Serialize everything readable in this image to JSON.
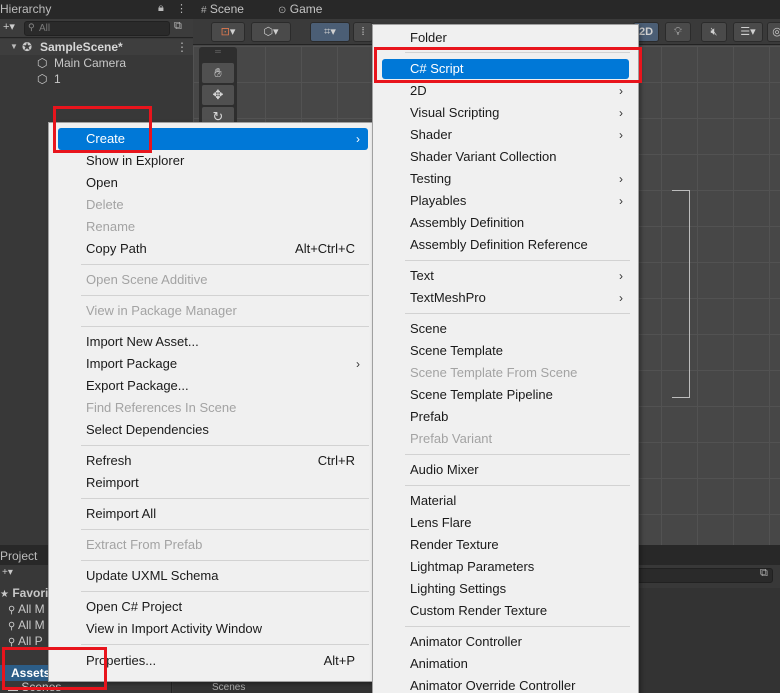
{
  "hierarchy": {
    "title": "Hierarchy",
    "search_placeholder": "All",
    "scene_name": "SampleScene*",
    "objects": [
      "Main Camera",
      "1"
    ]
  },
  "scene": {
    "tabs": [
      "Scene",
      "Game"
    ],
    "toggle_2d": "2D"
  },
  "project": {
    "title": "Project",
    "favorites": "Favorit",
    "fav_items": [
      "All M",
      "All M",
      "All P"
    ],
    "assets": "Assets",
    "scenes_left": "Scenes",
    "scenes_right": "Scenes"
  },
  "context_menu": {
    "items": [
      {
        "label": "Create",
        "highlighted": true,
        "submenu": true
      },
      {
        "label": "Show in Explorer"
      },
      {
        "label": "Open"
      },
      {
        "label": "Delete",
        "disabled": true
      },
      {
        "label": "Rename",
        "disabled": true
      },
      {
        "label": "Copy Path",
        "shortcut": "Alt+Ctrl+C"
      },
      {
        "label": "Open Scene Additive",
        "disabled": true
      },
      {
        "label": "View in Package Manager",
        "disabled": true
      },
      {
        "label": "Import New Asset..."
      },
      {
        "label": "Import Package",
        "submenu": true
      },
      {
        "label": "Export Package..."
      },
      {
        "label": "Find References In Scene",
        "disabled": true
      },
      {
        "label": "Select Dependencies"
      },
      {
        "label": "Refresh",
        "shortcut": "Ctrl+R"
      },
      {
        "label": "Reimport"
      },
      {
        "label": "Reimport All"
      },
      {
        "label": "Extract From Prefab",
        "disabled": true
      },
      {
        "label": "Update UXML Schema"
      },
      {
        "label": "Open C# Project"
      },
      {
        "label": "View in Import Activity Window"
      },
      {
        "label": "Properties...",
        "shortcut": "Alt+P"
      }
    ]
  },
  "create_submenu": {
    "items": [
      {
        "label": "Folder"
      },
      {
        "label": "C# Script",
        "highlighted": true
      },
      {
        "label": "2D",
        "submenu": true
      },
      {
        "label": "Visual Scripting",
        "submenu": true
      },
      {
        "label": "Shader",
        "submenu": true
      },
      {
        "label": "Shader Variant Collection"
      },
      {
        "label": "Testing",
        "submenu": true
      },
      {
        "label": "Playables",
        "submenu": true
      },
      {
        "label": "Assembly Definition"
      },
      {
        "label": "Assembly Definition Reference"
      },
      {
        "label": "Text",
        "submenu": true
      },
      {
        "label": "TextMeshPro",
        "submenu": true
      },
      {
        "label": "Scene"
      },
      {
        "label": "Scene Template"
      },
      {
        "label": "Scene Template From Scene",
        "disabled": true
      },
      {
        "label": "Scene Template Pipeline"
      },
      {
        "label": "Prefab"
      },
      {
        "label": "Prefab Variant",
        "disabled": true
      },
      {
        "label": "Audio Mixer"
      },
      {
        "label": "Material"
      },
      {
        "label": "Lens Flare"
      },
      {
        "label": "Render Texture"
      },
      {
        "label": "Lightmap Parameters"
      },
      {
        "label": "Lighting Settings"
      },
      {
        "label": "Custom Render Texture"
      },
      {
        "label": "Animator Controller"
      },
      {
        "label": "Animation"
      },
      {
        "label": "Animator Override Controller"
      }
    ]
  },
  "colors": {
    "highlight": "#0078d7",
    "annotation": "#e8141c",
    "menu_bg": "#f0f0f0",
    "selection": "#2c5d87"
  }
}
